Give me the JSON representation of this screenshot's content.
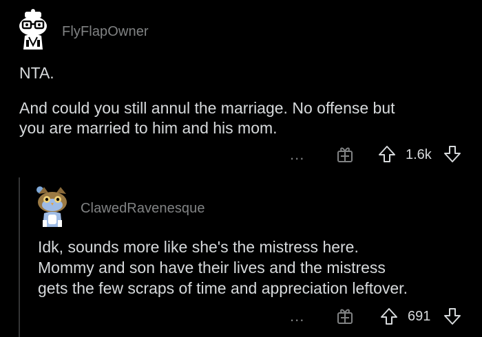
{
  "colors": {
    "background": "#000000",
    "text": "#d7dadc",
    "muted": "#818384",
    "thread_line": "#343536"
  },
  "comments": [
    {
      "username": "FlyFlapOwner",
      "avatar_icon": "snoo-avatar-icon",
      "lines": [
        "NTA.",
        "",
        "And could you still annul the marriage. No offense but",
        "you are married to him and his mom."
      ],
      "more_label": "...",
      "score": "1.6k"
    },
    {
      "username": "ClawedRavenesque",
      "avatar_icon": "owl-snoo-avatar-icon",
      "lines": [
        "Idk, sounds more like she's the mistress here.",
        "Mommy and son have their lives and the mistress",
        "gets the few scraps of time and appreciation leftover."
      ],
      "more_label": "...",
      "score": "691"
    }
  ]
}
